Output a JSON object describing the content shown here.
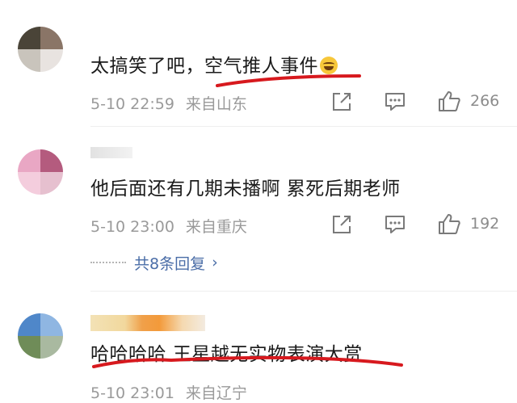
{
  "comments": [
    {
      "text": "太搞笑了吧，空气推人事件",
      "date": "5-10 22:59",
      "location": "来自山东",
      "likes": "266",
      "emoji_icon": "laugh-tears-emoji"
    },
    {
      "text": "他后面还有几期未播啊  累死后期老师",
      "date": "5-10 23:00",
      "location": "来自重庆",
      "likes": "192",
      "replies": "共8条回复"
    },
    {
      "text": "哈哈哈哈 王星越无实物表演大赏",
      "date": "5-10 23:01",
      "location": "来自辽宁"
    }
  ],
  "colors": {
    "underline": "#d7191e",
    "reply_link": "#4a6da7",
    "meta_text": "#9a9a9a"
  },
  "icons": [
    "share-icon",
    "comment-icon",
    "like-icon",
    "chevron-right-icon"
  ]
}
